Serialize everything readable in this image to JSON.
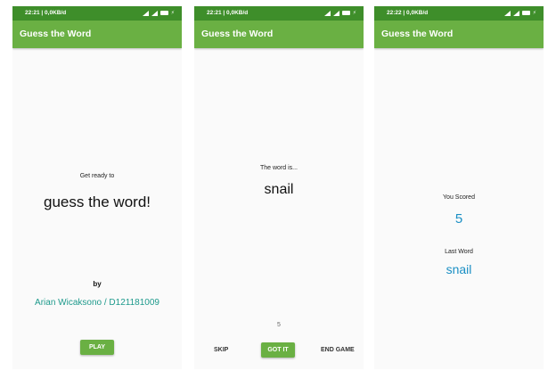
{
  "screens": [
    {
      "status": {
        "time_info": "22:21 | 0,0KB/d"
      },
      "app_title": "Guess the Word",
      "get_ready": "Get ready to",
      "headline": "guess the word!",
      "by_label": "by",
      "author": "Arian Wicaksono / D121181009",
      "play_button": "PLAY"
    },
    {
      "status": {
        "time_info": "22:21 | 0,0KB/d"
      },
      "app_title": "Guess the Word",
      "word_label": "The word is...",
      "word": "snail",
      "score": "5",
      "skip_button": "SKIP",
      "got_it_button": "GOT IT",
      "end_game_button": "END GAME"
    },
    {
      "status": {
        "time_info": "22:22 | 0,0KB/d"
      },
      "app_title": "Guess the Word",
      "you_scored_label": "You Scored",
      "score": "5",
      "last_word_label": "Last Word",
      "last_word": "snail"
    }
  ],
  "colors": {
    "status_bar": "#3e8e2a",
    "app_bar": "#6ab043",
    "accent_teal": "#1e9a8c",
    "accent_blue": "#1a8fc4"
  }
}
